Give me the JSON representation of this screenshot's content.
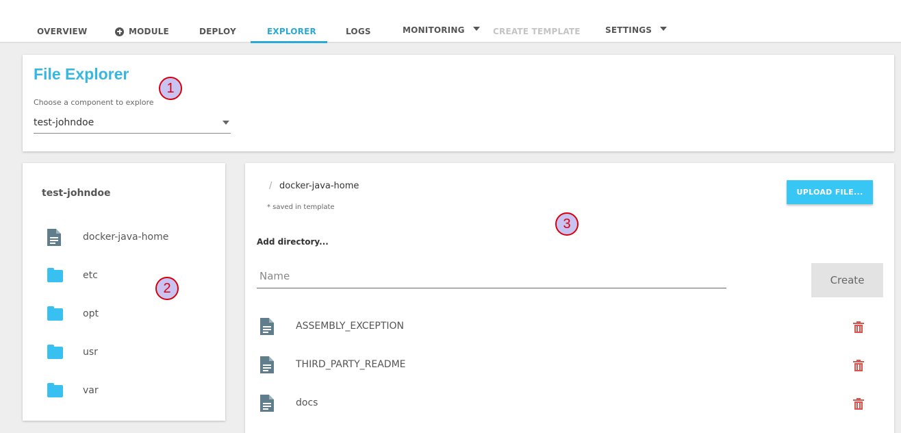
{
  "nav": {
    "tabs": [
      {
        "label": "OVERVIEW"
      },
      {
        "label": "MODULE",
        "icon": "plus-circle-icon"
      },
      {
        "label": "DEPLOY"
      },
      {
        "label": "EXPLORER",
        "active": true
      },
      {
        "label": "LOGS"
      },
      {
        "label": "MONITORING",
        "icon": "chevron-down-icon"
      },
      {
        "label": "CREATE TEMPLATE",
        "disabled": true
      },
      {
        "label": "SETTINGS",
        "icon": "chevron-down-icon"
      }
    ]
  },
  "header": {
    "title": "File Explorer",
    "select_label": "Choose a component to explore",
    "select_value": "test-johndoe"
  },
  "markers": [
    "1",
    "2",
    "3"
  ],
  "tree": {
    "root": "test-johndoe",
    "items": [
      {
        "label": "docker-java-home",
        "icon": "file-icon"
      },
      {
        "label": "etc",
        "icon": "folder-icon"
      },
      {
        "label": "opt",
        "icon": "folder-icon"
      },
      {
        "label": "usr",
        "icon": "folder-icon"
      },
      {
        "label": "var",
        "icon": "folder-icon"
      }
    ]
  },
  "detail": {
    "breadcrumb_sep": "/",
    "breadcrumb": "docker-java-home",
    "saved_note": "* saved in template",
    "upload_label": "UPLOAD FILE...",
    "add_dir_label": "Add directory...",
    "name_placeholder": "Name",
    "create_label": "Create",
    "files": [
      {
        "label": "ASSEMBLY_EXCEPTION"
      },
      {
        "label": "THIRD_PARTY_README"
      },
      {
        "label": "docs"
      }
    ]
  },
  "colors": {
    "accent": "#2aa9d8",
    "title": "#38b6e0",
    "upload_button": "#38c7f4",
    "folder": "#38c1f0",
    "file": "#607d8b",
    "delete": "#d9534f",
    "marker_fill": "#c9c3f2",
    "marker_border": "#d8000c"
  }
}
